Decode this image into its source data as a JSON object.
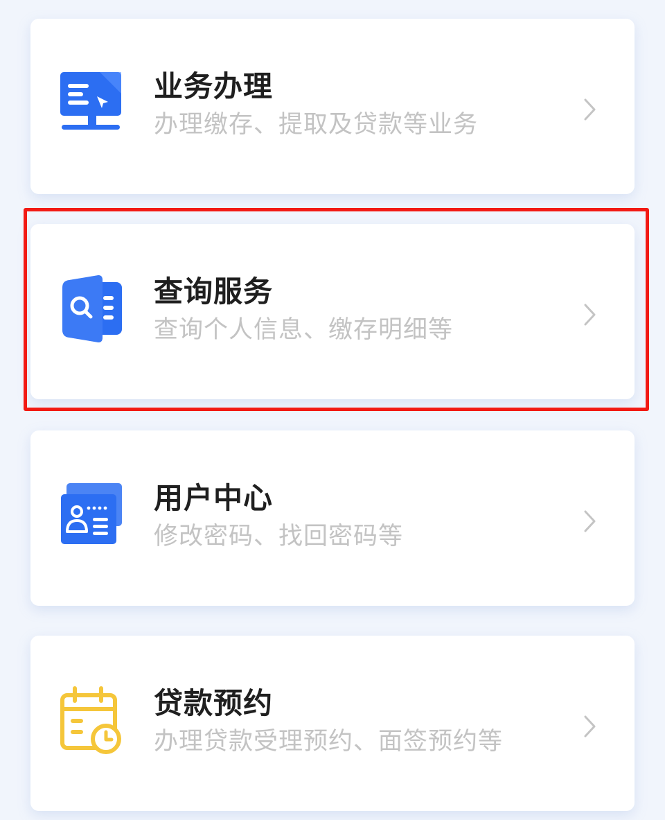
{
  "menu": {
    "items": [
      {
        "title": "业务办理",
        "subtitle": "办理缴存、提取及贷款等业务",
        "icon": "monitor-icon"
      },
      {
        "title": "查询服务",
        "subtitle": "查询个人信息、缴存明细等",
        "icon": "search-document-icon"
      },
      {
        "title": "用户中心",
        "subtitle": "修改密码、找回密码等",
        "icon": "user-card-icon"
      },
      {
        "title": "贷款预约",
        "subtitle": "办理贷款受理预约、面签预约等",
        "icon": "calendar-clock-icon"
      }
    ]
  },
  "colors": {
    "primary_blue": "#2c6ef2",
    "accent_yellow": "#f5c63a",
    "highlight_red": "#f21a14"
  }
}
